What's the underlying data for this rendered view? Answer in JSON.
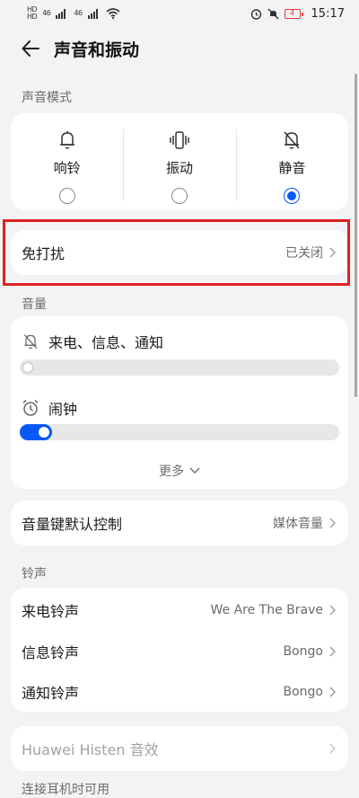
{
  "status_bar": {
    "left_badge_1": "HD",
    "left_badge_2": "HD",
    "net_1": "46",
    "net_2": "46",
    "battery_level": "4",
    "time": "15:17"
  },
  "header": {
    "title": "声音和振动"
  },
  "sound_mode": {
    "section_title": "声音模式",
    "modes": [
      {
        "label": "响铃",
        "selected": false
      },
      {
        "label": "振动",
        "selected": false
      },
      {
        "label": "静音",
        "selected": true
      }
    ]
  },
  "dnd": {
    "label": "免打扰",
    "value": "已关闭"
  },
  "volume": {
    "section_title": "音量",
    "calls_label": "来电、信息、通知",
    "calls_level": 0,
    "alarm_label": "闹钟",
    "alarm_level": 0.1,
    "more_label": "更多"
  },
  "volume_key": {
    "label": "音量键默认控制",
    "value": "媒体音量"
  },
  "ringtone": {
    "section_title": "铃声",
    "rows": [
      {
        "label": "来电铃声",
        "value": "We Are The Brave"
      },
      {
        "label": "信息铃声",
        "value": "Bongo"
      },
      {
        "label": "通知铃声",
        "value": "Bongo"
      }
    ]
  },
  "histen": {
    "label": "Huawei Histen 音效"
  },
  "headset": {
    "section_title": "连接耳机时可用"
  },
  "colors": {
    "accent": "#0a59f7",
    "highlight": "#e02020",
    "background": "#f1f3f5"
  }
}
